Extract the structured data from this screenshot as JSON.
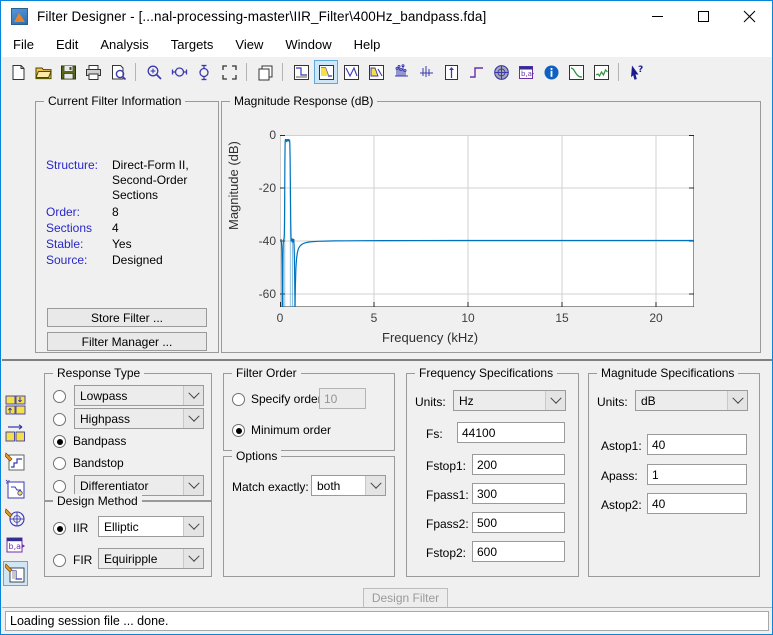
{
  "window": {
    "title": "Filter Designer -  [...nal-processing-master\\IIR_Filter\\400Hz_bandpass.fda]",
    "app_icon": "matlab-icon",
    "minimize": "minimize-icon",
    "maximize": "maximize-icon",
    "close": "close-icon",
    "accent": "#0a84d8"
  },
  "menu": {
    "items": [
      "File",
      "Edit",
      "Analysis",
      "Targets",
      "View",
      "Window",
      "Help"
    ]
  },
  "toolbar": {
    "buttons": [
      {
        "name": "new-file-icon",
        "group": 0
      },
      {
        "name": "open-file-icon",
        "group": 0
      },
      {
        "name": "save-file-icon",
        "group": 0
      },
      {
        "name": "print-icon",
        "group": 0
      },
      {
        "name": "print-preview-icon",
        "group": 0
      },
      {
        "name": "zoom-in-icon",
        "group": 1
      },
      {
        "name": "zoom-x-icon",
        "group": 1
      },
      {
        "name": "zoom-y-icon",
        "group": 1
      },
      {
        "name": "full-view-icon",
        "group": 1
      },
      {
        "name": "copy-figure-icon",
        "group": 2
      },
      {
        "name": "filter-specifications-icon",
        "group": 3
      },
      {
        "name": "magnitude-response-icon",
        "group": 3,
        "selected": true
      },
      {
        "name": "phase-response-icon",
        "group": 3
      },
      {
        "name": "magnitude-phase-icon",
        "group": 3
      },
      {
        "name": "group-delay-icon",
        "group": 3
      },
      {
        "name": "phase-delay-icon",
        "group": 3
      },
      {
        "name": "impulse-response-icon",
        "group": 3
      },
      {
        "name": "step-response-icon",
        "group": 3
      },
      {
        "name": "pole-zero-plot-icon",
        "group": 3
      },
      {
        "name": "filter-coefficients-icon",
        "group": 3
      },
      {
        "name": "filter-information-icon",
        "group": 3
      },
      {
        "name": "magnitude-estimate-icon",
        "group": 3
      },
      {
        "name": "round-off-noise-icon",
        "group": 3
      },
      {
        "name": "context-help-icon",
        "group": 4
      }
    ]
  },
  "sidebar": {
    "buttons": [
      {
        "name": "import-export-filter-icon"
      },
      {
        "name": "transform-filter-icon"
      },
      {
        "name": "set-quantization-icon"
      },
      {
        "name": "realize-model-icon"
      },
      {
        "name": "pole-zero-editor-icon"
      },
      {
        "name": "convert-structure-icon"
      },
      {
        "name": "design-filter-icon",
        "selected": true
      }
    ]
  },
  "current_filter_information": {
    "legend": "Current Filter Information",
    "rows": [
      {
        "key": "Structure:",
        "value": "Direct-Form II,\nSecond-Order\nSections"
      },
      {
        "key": "Order:",
        "value": "8"
      },
      {
        "key": "Sections",
        "value": "4"
      },
      {
        "key": "Stable:",
        "value": "Yes"
      },
      {
        "key": "Source:",
        "value": "Designed"
      }
    ],
    "structure_key": "Structure:",
    "structure_line1": "Direct-Form II,",
    "structure_line2": "Second-Order",
    "structure_line3": "Sections",
    "order_key": "Order:",
    "order_value": "8",
    "sections_key": "Sections",
    "sections_value": "4",
    "stable_key": "Stable:",
    "stable_value": "Yes",
    "source_key": "Source:",
    "source_value": "Designed",
    "store_filter_button": "Store Filter ...",
    "filter_manager_button": "Filter Manager ...",
    "key_color": "#2727c8"
  },
  "chart_panel": {
    "legend": "Magnitude Response (dB)"
  },
  "chart_data": {
    "type": "line",
    "title": "Magnitude Response (dB)",
    "xlabel": "Frequency (kHz)",
    "ylabel": "Magnitude (dB)",
    "xlim": [
      0,
      22.05
    ],
    "ylim": [
      -68,
      3
    ],
    "xticks": [
      0,
      5,
      10,
      15,
      20
    ],
    "xtick_labels": [
      "0",
      "5",
      "10",
      "15",
      "20"
    ],
    "yticks": [
      0,
      -20,
      -40,
      -60
    ],
    "ytick_labels": [
      "0",
      "-20",
      "-40",
      "-60"
    ],
    "grid": true,
    "legend_position": "none",
    "line_color": "#0072bd",
    "series": [
      {
        "name": "Magnitude",
        "x": [
          0.0,
          0.05,
          0.1,
          0.14,
          0.17,
          0.19,
          0.2,
          0.21,
          0.23,
          0.25,
          0.27,
          0.3,
          0.35,
          0.4,
          0.45,
          0.5,
          0.52,
          0.54,
          0.56,
          0.58,
          0.6,
          0.62,
          0.64,
          0.66,
          0.68,
          0.7,
          0.75,
          0.8,
          0.85,
          0.9,
          1.0,
          1.2,
          1.5,
          2.0,
          2.5,
          3.0,
          4.0,
          5.0,
          7.0,
          10.0,
          15.0,
          20.0,
          22.05
        ],
        "y": [
          -40.0,
          -41.5,
          -45.0,
          -62.0,
          -48.0,
          -43.0,
          -40.5,
          -30.0,
          -8.0,
          -1.0,
          -0.2,
          -0.05,
          -0.9,
          -0.1,
          -0.6,
          -0.3,
          -2.0,
          -12.0,
          -30.0,
          -41.0,
          -40.2,
          -41.5,
          -40.3,
          -44.0,
          -55.0,
          -68.0,
          -57.0,
          -50.5,
          -47.0,
          -45.0,
          -43.2,
          -41.8,
          -41.0,
          -40.6,
          -40.4,
          -40.3,
          -40.2,
          -40.15,
          -40.1,
          -40.05,
          -40.02,
          -40.0,
          -40.0
        ]
      }
    ]
  },
  "response_type": {
    "legend": "Response Type",
    "options": [
      {
        "label": "Lowpass",
        "type": "select",
        "selected": false
      },
      {
        "label": "Highpass",
        "type": "select",
        "selected": false
      },
      {
        "label": "Bandpass",
        "type": "radio",
        "selected": true
      },
      {
        "label": "Bandstop",
        "type": "radio",
        "selected": false
      },
      {
        "label": "Differentiator",
        "type": "select",
        "selected": false
      }
    ]
  },
  "design_method": {
    "legend": "Design Method",
    "iir_label": "IIR",
    "iir_value": "Elliptic",
    "iir_selected": true,
    "fir_label": "FIR",
    "fir_value": "Equiripple",
    "fir_selected": false
  },
  "filter_order": {
    "legend": "Filter Order",
    "specify_label": "Specify order:",
    "specify_value": "10",
    "specify_selected": false,
    "minimum_label": "Minimum order",
    "minimum_selected": true
  },
  "options": {
    "legend": "Options",
    "match_label": "Match exactly:",
    "match_value": "both"
  },
  "frequency_specifications": {
    "legend": "Frequency Specifications",
    "units_label": "Units:",
    "units_value": "Hz",
    "fields": [
      {
        "label": "Fs:",
        "value": "44100"
      },
      {
        "label": "Fstop1:",
        "value": "200"
      },
      {
        "label": "Fpass1:",
        "value": "300"
      },
      {
        "label": "Fpass2:",
        "value": "500"
      },
      {
        "label": "Fstop2:",
        "value": "600"
      }
    ],
    "fs_label": "Fs:",
    "fs_value": "44100",
    "fstop1_label": "Fstop1:",
    "fstop1_value": "200",
    "fpass1_label": "Fpass1:",
    "fpass1_value": "300",
    "fpass2_label": "Fpass2:",
    "fpass2_value": "500",
    "fstop2_label": "Fstop2:",
    "fstop2_value": "600"
  },
  "magnitude_specifications": {
    "legend": "Magnitude Specifications",
    "units_label": "Units:",
    "units_value": "dB",
    "astop1_label": "Astop1:",
    "astop1_value": "40",
    "apass_label": "Apass:",
    "apass_value": "1",
    "astop2_label": "Astop2:",
    "astop2_value": "40"
  },
  "design_filter_button": {
    "label": "Design Filter",
    "disabled": true
  },
  "status_bar": {
    "message": "Loading session file ... done."
  }
}
